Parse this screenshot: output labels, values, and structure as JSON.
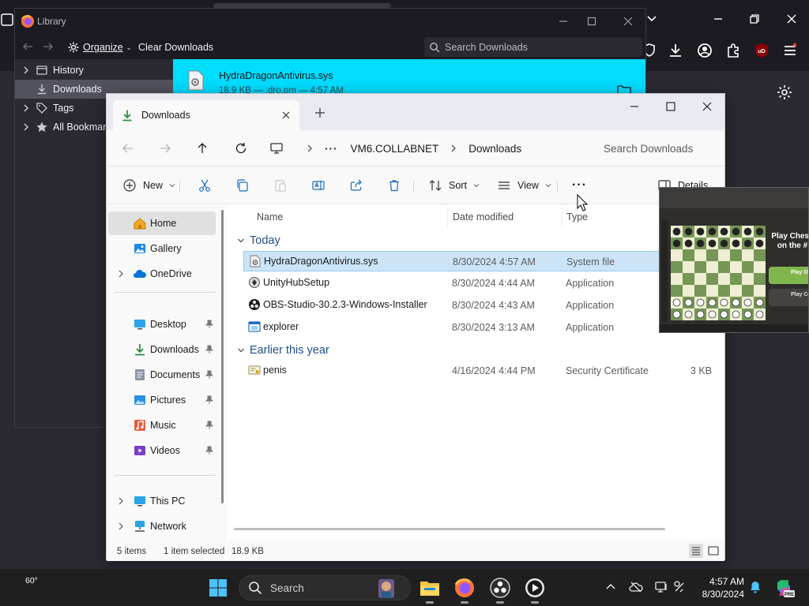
{
  "library": {
    "title": "Library",
    "organize_label": "Organize",
    "clear_label": "Clear Downloads",
    "search_placeholder": "Search Downloads",
    "tree": [
      {
        "label": "History",
        "icon": "history-icon"
      },
      {
        "label": "Downloads",
        "icon": "download-icon",
        "selected": true
      },
      {
        "label": "Tags",
        "icon": "tag-icon"
      },
      {
        "label": "All Bookmarks",
        "icon": "star-icon"
      }
    ],
    "download": {
      "name": "HydraDragonAntivirus.sys",
      "meta": "18.9 KB — .dro.pm — 4:57 AM"
    }
  },
  "explorer": {
    "tab_label": "Downloads",
    "breadcrumb": [
      "VM6.COLLABNET",
      "Downloads"
    ],
    "search_placeholder": "Search Downloads",
    "toolbar": {
      "new_label": "New",
      "sort_label": "Sort",
      "view_label": "View",
      "details_label": "Details"
    },
    "nav": {
      "home": "Home",
      "gallery": "Gallery",
      "onedrive": "OneDrive",
      "quick_access": [
        {
          "label": "Desktop",
          "icon": "desktop-icon"
        },
        {
          "label": "Downloads",
          "icon": "download-icon"
        },
        {
          "label": "Documents",
          "icon": "documents-icon"
        },
        {
          "label": "Pictures",
          "icon": "pictures-icon"
        },
        {
          "label": "Music",
          "icon": "music-icon"
        },
        {
          "label": "Videos",
          "icon": "videos-icon"
        }
      ],
      "this_pc": "This PC",
      "network": "Network"
    },
    "columns": {
      "name": "Name",
      "date": "Date modified",
      "type": "Type"
    },
    "groups": [
      {
        "label": "Today",
        "files": [
          {
            "name": "HydraDragonAntivirus.sys",
            "date": "8/30/2024 4:57 AM",
            "type": "System file",
            "size": "",
            "icon": "system-file-icon",
            "selected": true
          },
          {
            "name": "UnityHubSetup",
            "date": "8/30/2024 4:44 AM",
            "type": "Application",
            "size": "",
            "icon": "installer-icon"
          },
          {
            "name": "OBS-Studio-30.2.3-Windows-Installer",
            "date": "8/30/2024 4:43 AM",
            "type": "Application",
            "size": "",
            "icon": "obs-icon"
          },
          {
            "name": "explorer",
            "date": "8/30/2024 3:13 AM",
            "type": "Application",
            "size": "",
            "icon": "app-window-icon"
          }
        ]
      },
      {
        "label": "Earlier this year",
        "files": [
          {
            "name": "penis",
            "date": "4/16/2024 4:44 PM",
            "type": "Security Certificate",
            "size": "3 KB",
            "icon": "certificate-icon"
          }
        ]
      }
    ],
    "status": {
      "items": "5 items",
      "selected": "1 item selected",
      "size": "18.9 KB"
    }
  },
  "preview": {
    "title": "Play Chess on the #",
    "btn1": "Play Onl",
    "btn2": "Play Co"
  },
  "taskbar": {
    "temperature": "60°",
    "search_placeholder": "Search",
    "time": "4:57 AM",
    "date": "8/30/2024"
  },
  "colors": {
    "firefox_bg": "#1c1b22",
    "library_highlight": "#00ddff",
    "explorer_selected_row": "#cce4f7",
    "accent": "#1a6dbf"
  }
}
